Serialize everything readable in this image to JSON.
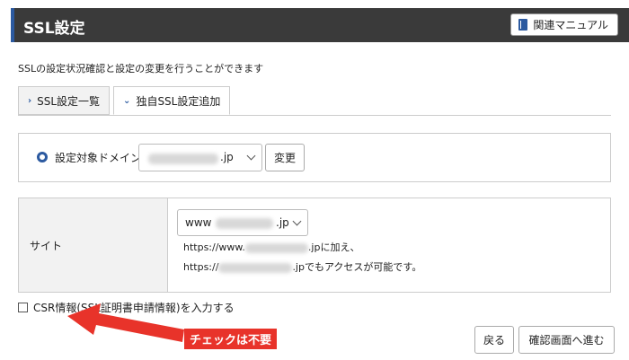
{
  "header": {
    "title": "SSL設定",
    "manual_button": "関連マニュアル",
    "accent_color": "#2c5aa0"
  },
  "description": "SSLの設定状況確認と設定の変更を行うことができます",
  "tabs": [
    {
      "label": "SSL設定一覧",
      "active": false
    },
    {
      "label": "独自SSL設定追加",
      "active": true
    }
  ],
  "domain": {
    "label": "設定対象ドメイン",
    "selected_suffix": ".jp",
    "change_button": "変更"
  },
  "site": {
    "label": "サイト",
    "select_prefix": "www",
    "select_suffix": ".jp",
    "line1_prefix": "https://www.",
    "line1_suffix": ".jpに加え、",
    "line2_prefix": "https://",
    "line2_suffix": ".jpでもアクセスが可能です。"
  },
  "csr": {
    "label": "CSR情報(SSL証明書申請情報)を入力する",
    "checked": false
  },
  "annotation": {
    "text": "チェックは不要",
    "color": "#e8332a"
  },
  "buttons": {
    "back": "戻る",
    "confirm": "確認画面へ進む"
  }
}
